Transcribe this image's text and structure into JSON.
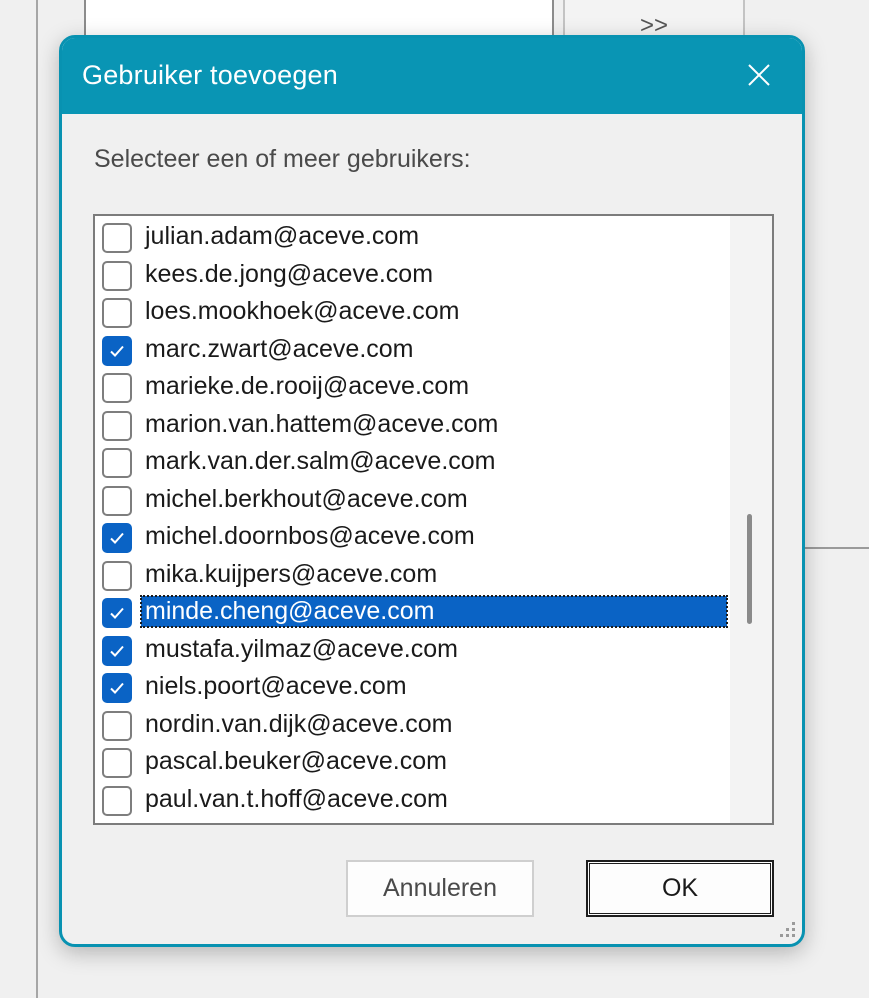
{
  "background": {
    "move_button_label": ">>"
  },
  "dialog": {
    "title": "Gebruiker toevoegen",
    "close_icon": "close-icon",
    "prompt": "Selecteer een of meer gebruikers:",
    "items": [
      {
        "email": "julian.adam@aceve.com",
        "checked": false
      },
      {
        "email": "kees.de.jong@aceve.com",
        "checked": false
      },
      {
        "email": "loes.mookhoek@aceve.com",
        "checked": false
      },
      {
        "email": "marc.zwart@aceve.com",
        "checked": true
      },
      {
        "email": "marieke.de.rooij@aceve.com",
        "checked": false
      },
      {
        "email": "marion.van.hattem@aceve.com",
        "checked": false
      },
      {
        "email": "mark.van.der.salm@aceve.com",
        "checked": false
      },
      {
        "email": "michel.berkhout@aceve.com",
        "checked": false
      },
      {
        "email": "michel.doornbos@aceve.com",
        "checked": true
      },
      {
        "email": "mika.kuijpers@aceve.com",
        "checked": false
      },
      {
        "email": "minde.cheng@aceve.com",
        "checked": true,
        "selected": true
      },
      {
        "email": "mustafa.yilmaz@aceve.com",
        "checked": true
      },
      {
        "email": "niels.poort@aceve.com",
        "checked": true
      },
      {
        "email": "nordin.van.dijk@aceve.com",
        "checked": false
      },
      {
        "email": "pascal.beuker@aceve.com",
        "checked": false
      },
      {
        "email": "paul.van.t.hoff@aceve.com",
        "checked": false
      }
    ],
    "cancel_label": "Annuleren",
    "ok_label": "OK"
  },
  "colors": {
    "accent": "#0995b4",
    "checkbox_checked": "#0a63c5",
    "selection": "#0a63c5"
  }
}
